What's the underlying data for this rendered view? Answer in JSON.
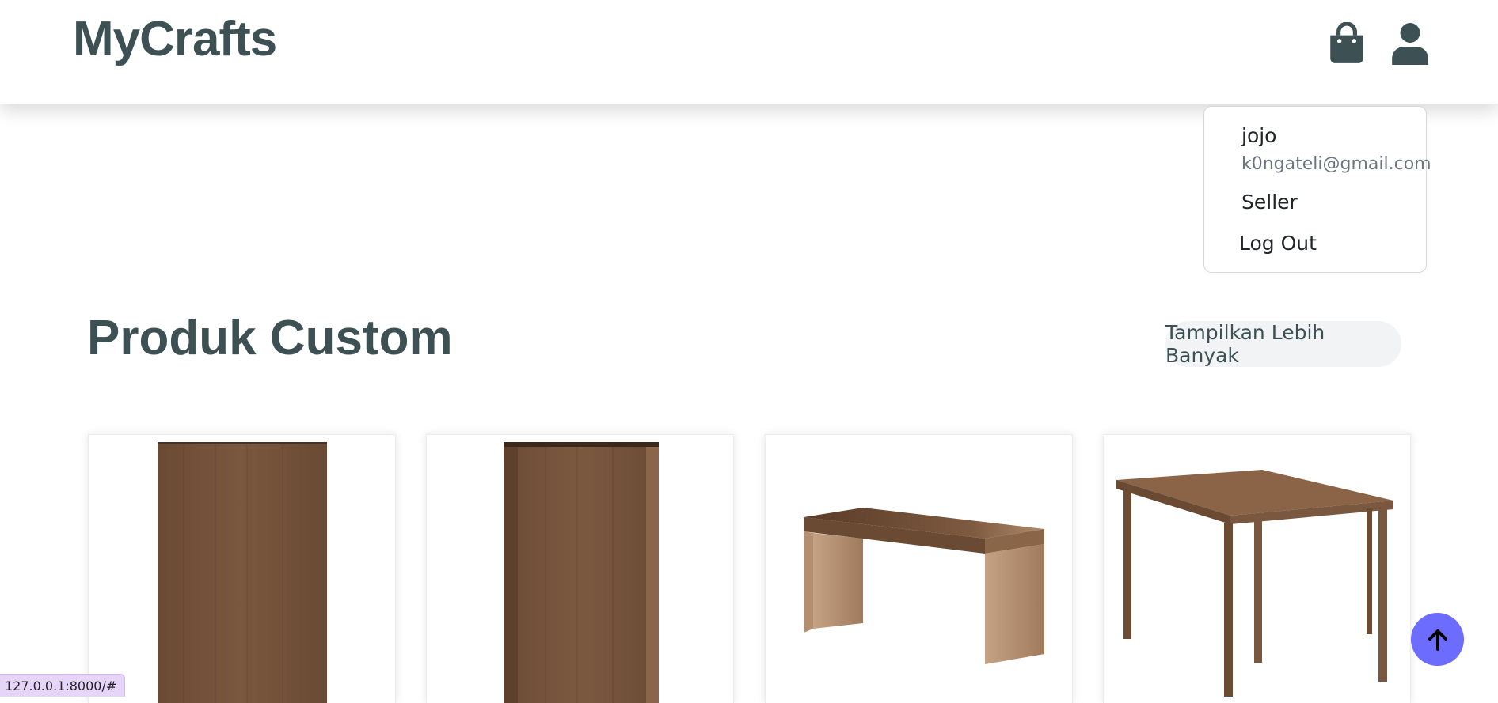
{
  "navbar": {
    "brand": "MyCrafts",
    "cart_icon": "shopping-bag-icon",
    "user_icon": "user-icon",
    "icon_color": "#3d5054"
  },
  "user_menu": {
    "name": "jojo",
    "email": "k0ngateli@gmail.com",
    "items": [
      "Seller",
      "Log Out"
    ]
  },
  "section": {
    "title": "Produk Custom",
    "more_label": "Tampilkan Lebih Banyak"
  },
  "products": [
    {
      "image": "wooden-cabinet-panel"
    },
    {
      "image": "wooden-wardrobe-door"
    },
    {
      "image": "wooden-bench"
    },
    {
      "image": "wooden-dining-table"
    }
  ],
  "scroll_top": {
    "icon": "arrow-up-icon",
    "color": "#6c6cff"
  },
  "status_bar": {
    "url": "127.0.0.1:8000/#"
  }
}
